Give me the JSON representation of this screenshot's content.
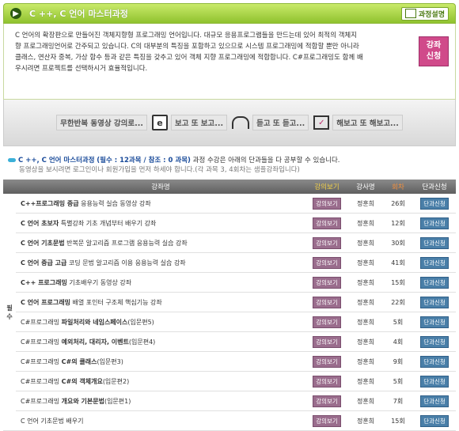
{
  "header": {
    "title": "C ++, C 언어 마스터과정",
    "detail_label": "과정설명"
  },
  "description": {
    "lines": [
      "C 언어의 확장판으로 만들어진 객체지향형 프로그래밍 언어입니다. 대규모 응용프로그램들을 만드는데 있어 최적의 객체지",
      "향 프로그래밍언어로 간주되고 있습니다. C의 대부분의 특징을 포함하고 있으므로 시스템 프로그래밍에 적합할 뿐만 아니라",
      "클래스, 연산자 중복, 가상 함수 등과 같은 특징을 갖추고 있어 객체 지향 프로그래밍에 적합합니다. C#프로그래밍도 함께 배",
      "우시려면 프로젝트를 선택하시거 효율적입니다."
    ],
    "apply_label_1": "강좌",
    "apply_label_2": "신청"
  },
  "steps": [
    {
      "label": "무한반복 동영상 강의로...",
      "icon": "none"
    },
    {
      "label": "보고 또 보고...",
      "icon": "e-book-icon"
    },
    {
      "label": "듣고 또 듣고...",
      "icon": "headphone-icon"
    },
    {
      "label": "해보고 또 해보고...",
      "icon": "practice-icon"
    }
  ],
  "info": {
    "course": "C ++, C 언어 마스터과정",
    "counts": "(필수 : 12과목 / 참조 : 0 과목)",
    "text": " 과정 수강은 아래의 단과들을 다 공부할 수 있습니다.",
    "sub": "동영상을 보시려면 로그인이나 회원가입을 먼저 하세야 합니다.(각 과목 3, 4회차는 샘플강좌입니다)"
  },
  "table": {
    "headers": {
      "name": "강좌명",
      "view": "강의보기",
      "teacher": "강사명",
      "count": "회차",
      "reg": "단과신청"
    },
    "side_label_1": "필",
    "side_label_2": "수",
    "view_label": "강의보기",
    "reg_label": "단과신청",
    "rows": [
      {
        "bold": "C++프로그래밍 중급",
        "rest": " 응용능력 실습 동영상 강좌",
        "teacher": "정훈희",
        "count": "26회"
      },
      {
        "bold": "C 언어 초보자",
        "rest": " 특별강좌 기초 개념부터 배우기 강좌",
        "teacher": "정훈희",
        "count": "12회"
      },
      {
        "bold": "C 언어 기초문법",
        "rest": " 반복문 알고리즘 프로그램 응용능력 실습 강좌",
        "teacher": "정훈희",
        "count": "30회"
      },
      {
        "bold": "C 언어 중급 고급",
        "rest": " 코딩 문법 알고리즘 이용 응용능력 실습 강좌",
        "teacher": "정훈희",
        "count": "41회"
      },
      {
        "bold": "C++ 프로그래밍",
        "rest": " 기초배우기 동영상 강좌",
        "teacher": "정훈희",
        "count": "15회"
      },
      {
        "bold": "C 언어 프로그래밍",
        "rest": " 배열 포인터 구조체 핵심기능 강좌",
        "teacher": "정훈희",
        "count": "22회"
      },
      {
        "pre": "C#프로그래밍 ",
        "bold": "파일처리와 네임스페이스",
        "rest": "(입문편5)",
        "teacher": "정훈희",
        "count": "5회"
      },
      {
        "pre": "C#프로그래밍 ",
        "bold": "예외처리, 대리자, 이벤트",
        "rest": "(입문편4)",
        "teacher": "정훈희",
        "count": "4회"
      },
      {
        "pre": "C#프로그래밍 ",
        "bold": "C#의 클래스",
        "rest": "(입문편3)",
        "teacher": "정훈희",
        "count": "9회"
      },
      {
        "pre": "C#프로그래밍 ",
        "bold": "C#의 객체개요",
        "rest": "(입문편2)",
        "teacher": "정훈희",
        "count": "5회"
      },
      {
        "pre": "C#프로그래밍 ",
        "bold": "개요와 기본문법",
        "rest": "(입문편1)",
        "teacher": "정훈희",
        "count": "7회"
      },
      {
        "pre": "C 언어 기초문법 배우기",
        "bold": "",
        "rest": "",
        "teacher": "정훈희",
        "count": "15회"
      }
    ]
  }
}
